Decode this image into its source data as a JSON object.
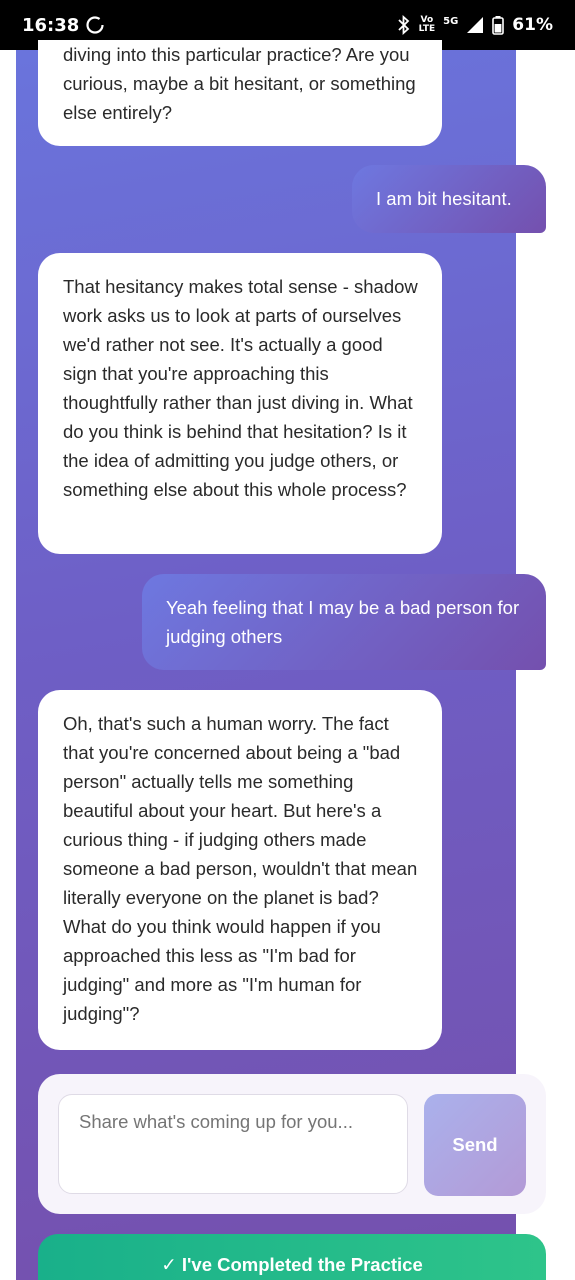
{
  "status_bar": {
    "time": "16:38",
    "network_top": "Vo",
    "network_bottom": "LTE",
    "network_type": "5G",
    "battery": "61%"
  },
  "messages": [
    {
      "role": "assistant",
      "text": "diving into this particular practice? Are you curious, maybe a bit hesitant, or something else entirely?"
    },
    {
      "role": "user",
      "text": "I am bit hesitant."
    },
    {
      "role": "assistant",
      "text": "That hesitancy makes total sense - shadow work asks us to look at parts of ourselves we'd rather not see. It's actually a good sign that you're approaching this thoughtfully rather than just diving in. What do you think is behind that hesitation? Is it the idea of admitting you judge others, or something else about this whole process?"
    },
    {
      "role": "user",
      "text": "Yeah feeling that I may be a bad person for judging others"
    },
    {
      "role": "assistant",
      "text": "Oh, that's such a human worry. The fact that you're concerned about being a \"bad person\" actually tells me something beautiful about your heart. But here's a curious thing - if judging others made someone a bad person, wouldn't that mean literally everyone on the planet is bad? What do you think would happen if you approached this less as \"I'm bad for judging\" and more as \"I'm human for judging\"?"
    }
  ],
  "composer": {
    "placeholder": "Share what's coming up for you...",
    "send_label": "Send"
  },
  "complete_button_label": "✓ I've Completed the Practice",
  "colors": {
    "chat_gradient_start": "#6a74dc",
    "chat_gradient_end": "#7550ad",
    "complete_green": "#19b08a"
  }
}
